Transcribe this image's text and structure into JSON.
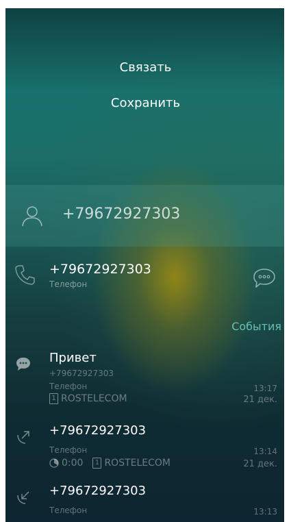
{
  "menu": {
    "link_label": "Связать",
    "save_label": "Сохранить"
  },
  "search": {
    "value": "+79672927303",
    "icon": "person-icon"
  },
  "contact": {
    "number": "+79672927303",
    "type": "Телефон",
    "call_icon": "phone-icon",
    "message_icon": "chat-bubble-icon"
  },
  "events_tab": "События",
  "events": [
    {
      "title": "Привет",
      "number": "+79672927303",
      "type": "Телефон",
      "sim": "1",
      "operator": "ROSTELECOM",
      "time": "13:17",
      "date": "21 дек.",
      "icon": "sms-icon"
    },
    {
      "title": "+79672927303",
      "type": "Телефон",
      "duration": "0:00",
      "sim": "1",
      "operator": "ROSTELECOM",
      "time": "13:14",
      "date": "21 дек.",
      "icon": "outgoing-call-icon"
    },
    {
      "title": "+79672927303",
      "type": "Телефон",
      "time": "13:13",
      "icon": "incoming-call-icon"
    }
  ]
}
